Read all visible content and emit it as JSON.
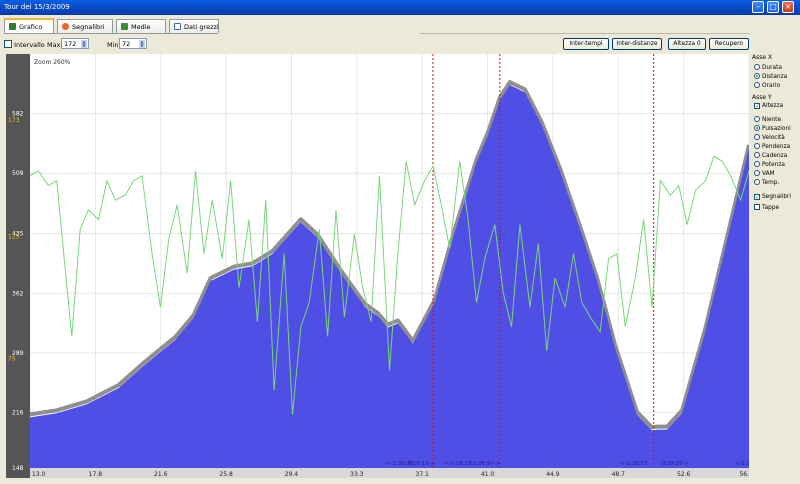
{
  "window": {
    "title": "Tour del 15/3/2009",
    "controls": [
      "minimize-icon",
      "maximize-icon",
      "close-icon"
    ]
  },
  "tabs": [
    {
      "label": "Grafico",
      "icon": "chart-icon",
      "active": true
    },
    {
      "label": "Segnalibri",
      "icon": "bookmark-icon",
      "active": false
    },
    {
      "label": "Medie",
      "icon": "averages-icon",
      "active": false
    },
    {
      "label": "Dati grezzi",
      "icon": "table-icon",
      "active": false
    }
  ],
  "toolbar": {
    "intervallo_label": "Intervallo",
    "intervallo_checked": false,
    "max_label": "Max",
    "max_value": "172",
    "min_label": "Min",
    "min_value": "72",
    "buttons": [
      "Inter-tempi",
      "Inter-distanze",
      "Altezza 0",
      "Recupero"
    ]
  },
  "side_panel": {
    "x_axis_label": "Asse X",
    "x_options": [
      {
        "label": "Durata",
        "selected": false
      },
      {
        "label": "Distanza",
        "selected": true
      },
      {
        "label": "Orario",
        "selected": false
      }
    ],
    "y_axis_label": "Asse Y",
    "altitude": {
      "label": "Altezza",
      "checked": true
    },
    "y_options": [
      {
        "label": "Niente",
        "selected": false
      },
      {
        "label": "Pulsazioni",
        "selected": true
      },
      {
        "label": "Velocità",
        "selected": false
      },
      {
        "label": "Pendenza",
        "selected": false
      },
      {
        "label": "Cadenza",
        "selected": false
      },
      {
        "label": "Potenza",
        "selected": false
      },
      {
        "label": "VAM",
        "selected": false
      },
      {
        "label": "Temp.",
        "selected": false
      }
    ],
    "checkboxes": [
      {
        "label": "Segnalibri",
        "checked": true
      },
      {
        "label": "Tappe",
        "checked": false
      }
    ]
  },
  "chart_data": {
    "type": "area",
    "zoom_label": "Zoom 260%",
    "x_ticks": [
      "13.0",
      "17.8",
      "21.6",
      "25.8",
      "29.4",
      "33.3",
      "37.1",
      "41.0",
      "44.9",
      "48.7",
      "52.6",
      "56."
    ],
    "x_range": [
      13.0,
      56.0
    ],
    "y_ticks_left": [
      "148",
      "216",
      "289",
      "362",
      "435",
      "509",
      "582"
    ],
    "y_range": [
      148,
      655
    ],
    "y2_ticks": [
      "75",
      "125",
      "173"
    ],
    "y2_range": [
      30,
      200
    ],
    "grid": true,
    "colors": {
      "plot_bg": "#ffffff",
      "altitude_fill": "#4f4fe6",
      "altitude_shadow": "#8f8f8f",
      "heart_rate_line": "#7ad67a",
      "bookmark_line": "#c81010",
      "axis_strip": "#555555",
      "tick_text": "#ffffff",
      "y2_tick_text": "#e8c040",
      "label_text": "#1e1e8c"
    },
    "series": [
      {
        "name": "Altezza",
        "kind": "area",
        "x": [
          13.0,
          14.6,
          16.4,
          18.3,
          19.9,
          21.7,
          22.8,
          23.8,
          25.2,
          26.3,
          27.5,
          28.5,
          29.2,
          30.2,
          31.6,
          33.0,
          33.8,
          34.4,
          35.0,
          35.9,
          37.2,
          38.3,
          39.1,
          39.7,
          40.4,
          41.1,
          41.7,
          42.6,
          43.6,
          44.7,
          45.9,
          46.9,
          47.5,
          48.0,
          48.6,
          49.3,
          50.2,
          50.5,
          51.1,
          52.0,
          53.4,
          54.7,
          56.0
        ],
        "y": [
          210,
          215,
          226,
          246,
          275,
          305,
          332,
          377,
          391,
          395,
          410,
          433,
          449,
          430,
          386,
          346,
          334,
          320,
          325,
          300,
          350,
          430,
          482,
          522,
          556,
          598,
          617,
          608,
          568,
          511,
          440,
          378,
          333,
          294,
          257,
          213,
          194,
          195,
          195,
          215,
          316,
          428,
          540
        ]
      },
      {
        "name": "Pulsazioni",
        "kind": "line",
        "x": [
          13.0,
          13.5,
          14.1,
          14.6,
          15.1,
          15.5,
          16.0,
          16.5,
          17.1,
          17.6,
          18.1,
          18.7,
          19.2,
          19.7,
          20.3,
          20.8,
          21.3,
          21.8,
          22.4,
          22.9,
          23.4,
          23.9,
          24.5,
          25.0,
          25.5,
          26.1,
          26.6,
          27.1,
          27.6,
          28.2,
          28.7,
          29.2,
          29.7,
          30.3,
          30.8,
          31.3,
          31.8,
          32.4,
          32.9,
          33.4,
          33.9,
          34.5,
          35.0,
          35.5,
          36.0,
          36.6,
          37.1,
          37.6,
          38.1,
          38.7,
          39.2,
          39.7,
          40.2,
          40.8,
          41.3,
          41.8,
          42.3,
          42.9,
          43.4,
          43.9,
          44.4,
          45.0,
          45.5,
          46.0,
          46.5,
          47.1,
          47.6,
          48.1,
          48.6,
          49.2,
          49.7,
          50.2,
          50.7,
          51.3,
          51.8,
          52.3,
          52.8,
          53.4,
          53.9,
          54.4,
          54.9,
          55.5,
          56.0
        ],
        "y": [
          150,
          152,
          146,
          148,
          112,
          84,
          128,
          136,
          132,
          148,
          140,
          142,
          148,
          150,
          118,
          96,
          124,
          138,
          110,
          152,
          118,
          140,
          116,
          148,
          104,
          132,
          90,
          140,
          62,
          118,
          52,
          88,
          98,
          128,
          84,
          136,
          92,
          126,
          104,
          90,
          150,
          70,
          118,
          156,
          138,
          148,
          154,
          138,
          120,
          156,
          132,
          98,
          116,
          130,
          102,
          88,
          130,
          96,
          122,
          78,
          108,
          96,
          118,
          98,
          92,
          86,
          116,
          118,
          88,
          108,
          132,
          96,
          148,
          142,
          146,
          130,
          144,
          148,
          158,
          156,
          150,
          140,
          152
        ]
      }
    ],
    "bookmark_x": [
      37.1,
      41.1,
      50.3
    ],
    "bookmark_labels": [
      {
        "x": 35.1,
        "text": "<-1:30:28"
      },
      {
        "x": 36.4,
        "text": "0:16:15->"
      },
      {
        "x": 38.6,
        "text": "<-0:16:15"
      },
      {
        "x": 40.3,
        "text": "0:28:57->"
      },
      {
        "x": 49.1,
        "text": "<-0:28:57"
      },
      {
        "x": 51.6,
        "text": "0:29:25->"
      },
      {
        "x": 55.6,
        "text": "<-0:2"
      }
    ]
  }
}
